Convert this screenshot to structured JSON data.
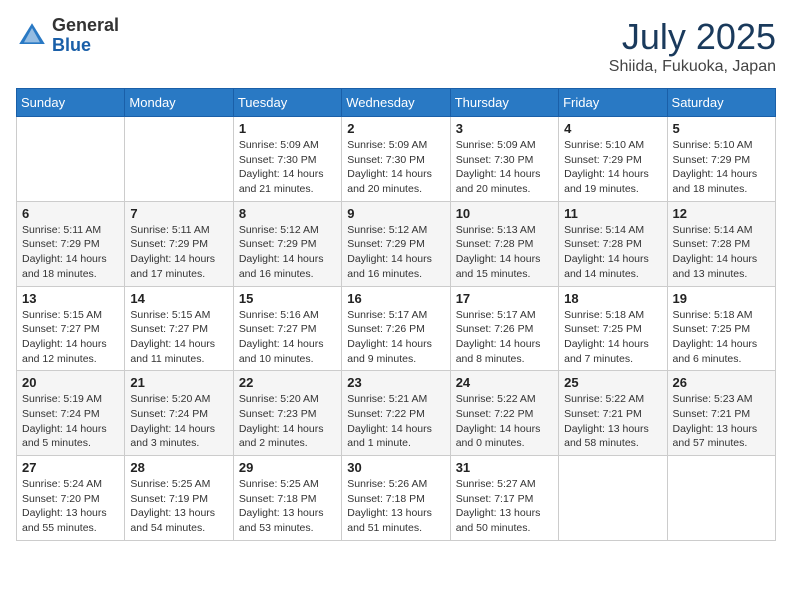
{
  "logo": {
    "general": "General",
    "blue": "Blue"
  },
  "title": "July 2025",
  "location": "Shiida, Fukuoka, Japan",
  "days_of_week": [
    "Sunday",
    "Monday",
    "Tuesday",
    "Wednesday",
    "Thursday",
    "Friday",
    "Saturday"
  ],
  "weeks": [
    [
      {
        "day": "",
        "info": ""
      },
      {
        "day": "",
        "info": ""
      },
      {
        "day": "1",
        "info": "Sunrise: 5:09 AM\nSunset: 7:30 PM\nDaylight: 14 hours and 21 minutes."
      },
      {
        "day": "2",
        "info": "Sunrise: 5:09 AM\nSunset: 7:30 PM\nDaylight: 14 hours and 20 minutes."
      },
      {
        "day": "3",
        "info": "Sunrise: 5:09 AM\nSunset: 7:30 PM\nDaylight: 14 hours and 20 minutes."
      },
      {
        "day": "4",
        "info": "Sunrise: 5:10 AM\nSunset: 7:29 PM\nDaylight: 14 hours and 19 minutes."
      },
      {
        "day": "5",
        "info": "Sunrise: 5:10 AM\nSunset: 7:29 PM\nDaylight: 14 hours and 18 minutes."
      }
    ],
    [
      {
        "day": "6",
        "info": "Sunrise: 5:11 AM\nSunset: 7:29 PM\nDaylight: 14 hours and 18 minutes."
      },
      {
        "day": "7",
        "info": "Sunrise: 5:11 AM\nSunset: 7:29 PM\nDaylight: 14 hours and 17 minutes."
      },
      {
        "day": "8",
        "info": "Sunrise: 5:12 AM\nSunset: 7:29 PM\nDaylight: 14 hours and 16 minutes."
      },
      {
        "day": "9",
        "info": "Sunrise: 5:12 AM\nSunset: 7:29 PM\nDaylight: 14 hours and 16 minutes."
      },
      {
        "day": "10",
        "info": "Sunrise: 5:13 AM\nSunset: 7:28 PM\nDaylight: 14 hours and 15 minutes."
      },
      {
        "day": "11",
        "info": "Sunrise: 5:14 AM\nSunset: 7:28 PM\nDaylight: 14 hours and 14 minutes."
      },
      {
        "day": "12",
        "info": "Sunrise: 5:14 AM\nSunset: 7:28 PM\nDaylight: 14 hours and 13 minutes."
      }
    ],
    [
      {
        "day": "13",
        "info": "Sunrise: 5:15 AM\nSunset: 7:27 PM\nDaylight: 14 hours and 12 minutes."
      },
      {
        "day": "14",
        "info": "Sunrise: 5:15 AM\nSunset: 7:27 PM\nDaylight: 14 hours and 11 minutes."
      },
      {
        "day": "15",
        "info": "Sunrise: 5:16 AM\nSunset: 7:27 PM\nDaylight: 14 hours and 10 minutes."
      },
      {
        "day": "16",
        "info": "Sunrise: 5:17 AM\nSunset: 7:26 PM\nDaylight: 14 hours and 9 minutes."
      },
      {
        "day": "17",
        "info": "Sunrise: 5:17 AM\nSunset: 7:26 PM\nDaylight: 14 hours and 8 minutes."
      },
      {
        "day": "18",
        "info": "Sunrise: 5:18 AM\nSunset: 7:25 PM\nDaylight: 14 hours and 7 minutes."
      },
      {
        "day": "19",
        "info": "Sunrise: 5:18 AM\nSunset: 7:25 PM\nDaylight: 14 hours and 6 minutes."
      }
    ],
    [
      {
        "day": "20",
        "info": "Sunrise: 5:19 AM\nSunset: 7:24 PM\nDaylight: 14 hours and 5 minutes."
      },
      {
        "day": "21",
        "info": "Sunrise: 5:20 AM\nSunset: 7:24 PM\nDaylight: 14 hours and 3 minutes."
      },
      {
        "day": "22",
        "info": "Sunrise: 5:20 AM\nSunset: 7:23 PM\nDaylight: 14 hours and 2 minutes."
      },
      {
        "day": "23",
        "info": "Sunrise: 5:21 AM\nSunset: 7:22 PM\nDaylight: 14 hours and 1 minute."
      },
      {
        "day": "24",
        "info": "Sunrise: 5:22 AM\nSunset: 7:22 PM\nDaylight: 14 hours and 0 minutes."
      },
      {
        "day": "25",
        "info": "Sunrise: 5:22 AM\nSunset: 7:21 PM\nDaylight: 13 hours and 58 minutes."
      },
      {
        "day": "26",
        "info": "Sunrise: 5:23 AM\nSunset: 7:21 PM\nDaylight: 13 hours and 57 minutes."
      }
    ],
    [
      {
        "day": "27",
        "info": "Sunrise: 5:24 AM\nSunset: 7:20 PM\nDaylight: 13 hours and 55 minutes."
      },
      {
        "day": "28",
        "info": "Sunrise: 5:25 AM\nSunset: 7:19 PM\nDaylight: 13 hours and 54 minutes."
      },
      {
        "day": "29",
        "info": "Sunrise: 5:25 AM\nSunset: 7:18 PM\nDaylight: 13 hours and 53 minutes."
      },
      {
        "day": "30",
        "info": "Sunrise: 5:26 AM\nSunset: 7:18 PM\nDaylight: 13 hours and 51 minutes."
      },
      {
        "day": "31",
        "info": "Sunrise: 5:27 AM\nSunset: 7:17 PM\nDaylight: 13 hours and 50 minutes."
      },
      {
        "day": "",
        "info": ""
      },
      {
        "day": "",
        "info": ""
      }
    ]
  ]
}
